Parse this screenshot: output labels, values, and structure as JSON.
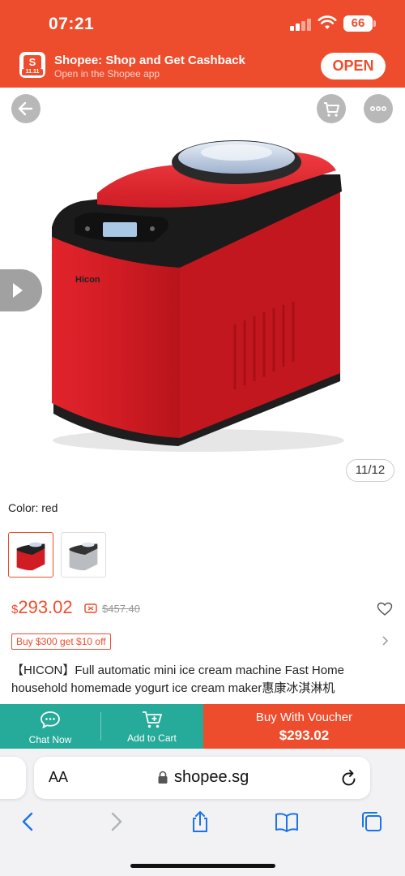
{
  "status_bar": {
    "time": "07:21",
    "battery": "66"
  },
  "banner": {
    "logo_text": "S",
    "logo_badge": "11.11",
    "title": "Shopee: Shop and Get Cashback",
    "subtitle": "Open in the Shopee app",
    "open_label": "OPEN"
  },
  "product": {
    "brand_on_device": "Hicon",
    "image_counter": "11/12",
    "color_label": "Color: red",
    "variants": [
      "red",
      "silver"
    ],
    "selected_variant": "red",
    "price_currency": "$",
    "price": "293.02",
    "original_price": "$457.40",
    "voucher_tag": "Buy $300 get $10 off",
    "title": "【HICON】Full automatic mini ice cream machine Fast Home household homemade yogurt ice cream maker惠康冰淇淋机"
  },
  "action_bar": {
    "chat_label": "Chat Now",
    "cart_label": "Add to Cart",
    "buy_label": "Buy With Voucher",
    "buy_price": "$293.02"
  },
  "browser": {
    "aa_label": "AA",
    "url": "shopee.sg"
  },
  "colors": {
    "brand": "#ee4d2d",
    "teal": "#26aa99",
    "machine_red": "#d91e26"
  },
  "icons": [
    "back-icon",
    "cart-icon",
    "more-icon",
    "play-icon",
    "promo-icon",
    "heart-icon",
    "chevron-right-icon",
    "chat-icon",
    "add-to-cart-icon",
    "lock-icon",
    "reload-icon",
    "browser-back-icon",
    "browser-forward-icon",
    "share-icon",
    "bookmarks-icon",
    "tabs-icon"
  ]
}
